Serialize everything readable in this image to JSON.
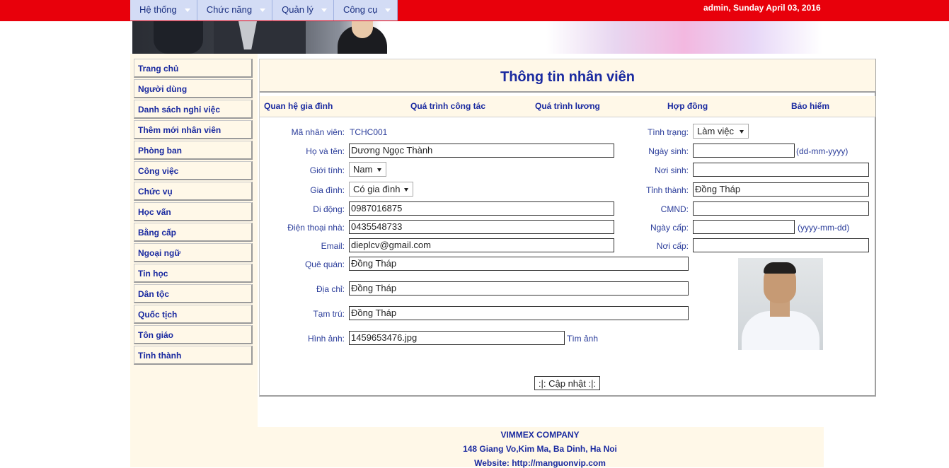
{
  "menu": [
    {
      "label": "Hệ thống"
    },
    {
      "label": "Chức năng"
    },
    {
      "label": "Quản lý"
    },
    {
      "label": "Công cụ"
    }
  ],
  "user_info": "admin, Sunday April 03, 2016",
  "sidebar": {
    "items": [
      {
        "label": "Trang chủ"
      },
      {
        "label": "Người dùng"
      },
      {
        "label": "Danh sách nghỉ việc"
      },
      {
        "label": "Thêm mới nhân viên"
      },
      {
        "label": "Phòng ban"
      },
      {
        "label": "Công việc"
      },
      {
        "label": "Chức vụ"
      },
      {
        "label": "Học vấn"
      },
      {
        "label": "Bằng cấp"
      },
      {
        "label": "Ngoại ngữ"
      },
      {
        "label": "Tin học"
      },
      {
        "label": "Dân tộc"
      },
      {
        "label": "Quốc tịch"
      },
      {
        "label": "Tôn giáo"
      },
      {
        "label": "Tỉnh thành"
      }
    ]
  },
  "panel": {
    "title": "Thông tin nhân viên",
    "tabs": [
      "Quan hệ gia đình",
      "Quá trình công tác",
      "Quá trình lương",
      "Hợp đồng",
      "Bảo hiểm"
    ]
  },
  "form": {
    "employee_id_label": "Mã nhân viên:",
    "employee_id": "TCHC001",
    "full_name_label": "Họ và tên:",
    "full_name": "Dương Ngọc Thành",
    "gender_label": "Giới tính:",
    "gender": "Nam",
    "family_label": "Gia đình:",
    "family": "Có gia đình",
    "mobile_label": "Di động:",
    "mobile": "0987016875",
    "home_phone_label": "Điện thoại nhà:",
    "home_phone": "0435548733",
    "email_label": "Email:",
    "email": "dieplcv@gmail.com",
    "hometown_label": "Quê quán:",
    "hometown": "Đồng Tháp",
    "address_label": "Địa chỉ:",
    "address": "Đồng Tháp",
    "temp_address_label": "Tạm trú:",
    "temp_address": "Đồng Tháp",
    "image_label": "Hình ảnh:",
    "image_file": "1459653476.jpg",
    "find_image": "Tìm ảnh",
    "status_label": "Tình trạng:",
    "status": "Làm việc",
    "birth_date_label": "Ngày sinh:",
    "birth_date": "",
    "birth_date_hint": "(dd-mm-yyyy)",
    "birth_place_label": "Nơi sinh:",
    "birth_place": "",
    "province_label": "Tỉnh thành:",
    "province": "Đồng Tháp",
    "id_card_label": "CMND:",
    "id_card": "",
    "issue_date_label": "Ngày cấp:",
    "issue_date": "",
    "issue_date_hint": "(yyyy-mm-dd)",
    "issue_place_label": "Nơi cấp:",
    "issue_place": "",
    "update_button": ":|: Cập nhật :|:"
  },
  "footer": {
    "company": "VIMMEX COMPANY",
    "address": "148 Giang Vo,Kim Ma, Ba Dinh, Ha Noi",
    "website": "Website: http://manguonvip.com"
  }
}
